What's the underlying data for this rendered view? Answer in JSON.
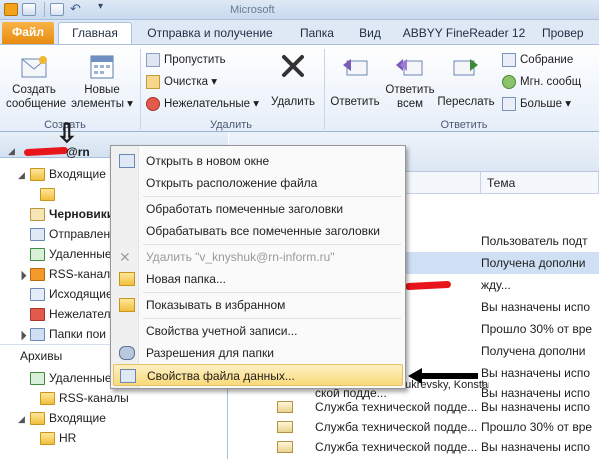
{
  "title_bar": {
    "title": "Microsoft"
  },
  "tabs": [
    {
      "label": "Файл"
    },
    {
      "label": "Главная"
    },
    {
      "label": "Отправка и получение"
    },
    {
      "label": "Папка"
    },
    {
      "label": "Вид"
    },
    {
      "label": "ABBYY FineReader 12"
    },
    {
      "label": "Провер"
    }
  ],
  "ribbon": {
    "create_label_1": "Создать",
    "create_label_2": "сообщение",
    "new_items_label_1": "Новые",
    "new_items_label_2": "элементы ▾",
    "ignore_label": "Пропустить",
    "cleanup_label": "Очистка ▾",
    "junk_label": "Нежелательные ▾",
    "delete_label": "Удалить",
    "reply_label": "Ответить",
    "reply_all_label_1": "Ответить",
    "reply_all_label_2": "всем",
    "forward_label": "Переслать",
    "meeting_label": "Собрание",
    "im_label": "Мгн. сообщ",
    "more_label": "Больше ▾",
    "group_create": "Создать",
    "group_delete": "Удалить",
    "group_reply": "Ответить"
  },
  "nav": {
    "account_suffix": "@rn",
    "inbox": "Входящие",
    "drafts": "Черновики",
    "sent": "Отправлен",
    "deleted": "Удаленные",
    "rss": "RSS-каналь",
    "outbox": "Исходящие",
    "junk": "Нежелатель",
    "search_folders": "Папки пои",
    "archives": "Архивы",
    "arch_deleted": "Удаленные",
    "arch_rss": "RSS-каналы",
    "arch_inbox": "Входящие",
    "arch_hr": "HR"
  },
  "mail": {
    "col_subject": "Тема",
    "rows": [
      {
        "from": "ской подде...",
        "subject": "Пользователь подт"
      },
      {
        "from": "ской подде...",
        "subject": "Получена дополни"
      },
      {
        "from": "",
        "subject": "жду..."
      },
      {
        "from": "ской подде...",
        "subject": "Вы назначены испо"
      },
      {
        "from": "ской подде...",
        "subject": "Прошло 30% от вре"
      },
      {
        "from": "ской подде...",
        "subject": "Получена дополни"
      },
      {
        "from": "ской подде...",
        "subject": "Вы назначены испо"
      },
      {
        "from": "ской подде...",
        "subject": "Вы назначены испо"
      },
      {
        "from": "Lukrevsky, Konstantin E.",
        "subject": "!"
      },
      {
        "from": "Служба технической подде...",
        "subject": "Вы назначены испо"
      },
      {
        "from": "Служба технической подде...",
        "subject": "Прошло 30% от вре"
      },
      {
        "from": "Служба технической подде...",
        "subject": "Вы назначены испо"
      }
    ]
  },
  "context_menu": {
    "open_new_window": "Открыть в новом окне",
    "open_file_location": "Открыть расположение файла",
    "process_marked_headers": "Обработать помеченные заголовки",
    "process_all_marked_headers": "Обрабатывать все помеченные заголовки",
    "delete_account": "Удалить \"v_knyshuk@rn-inform.ru\"",
    "new_folder": "Новая папка...",
    "show_in_favorites": "Показывать в избранном",
    "account_properties": "Свойства учетной записи...",
    "folder_permissions": "Разрешения для папки",
    "data_file_properties": "Свойства файла данных..."
  }
}
